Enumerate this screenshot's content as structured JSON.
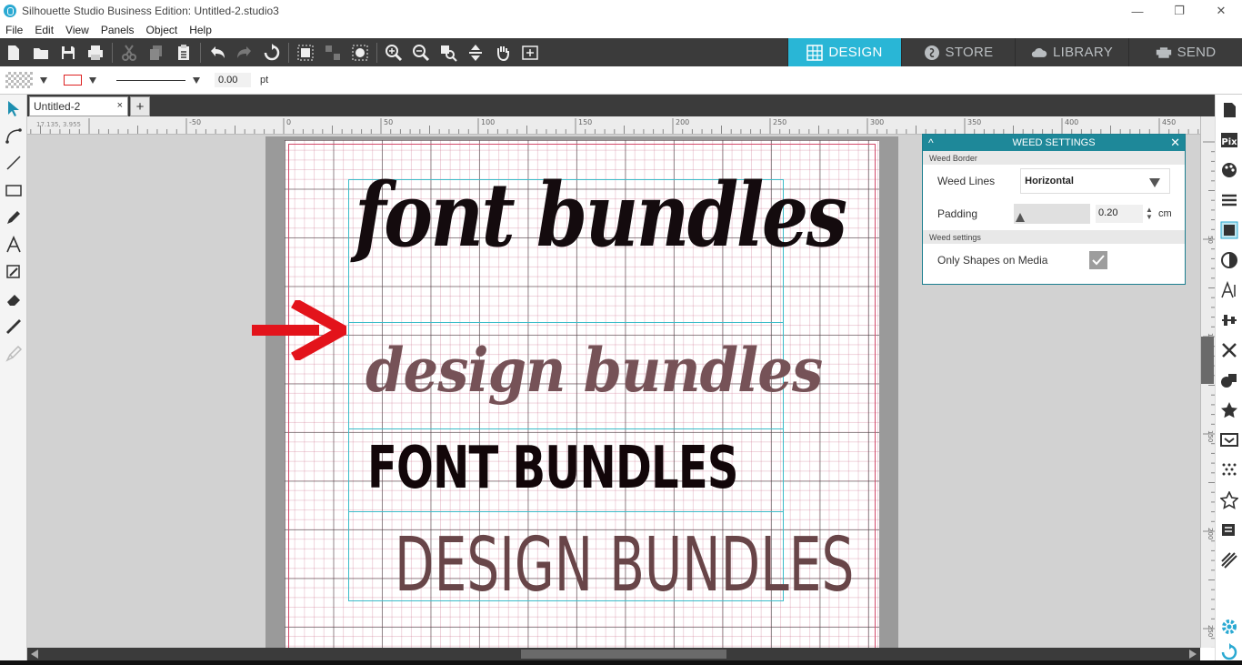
{
  "window": {
    "title": "Silhouette Studio Business Edition: Untitled-2.studio3",
    "controls": {
      "minimize": "—",
      "maximize": "❐",
      "close": "✕"
    }
  },
  "menu": [
    "File",
    "Edit",
    "View",
    "Panels",
    "Object",
    "Help"
  ],
  "toolbar": {
    "icons": [
      "new-icon",
      "open-icon",
      "save-icon",
      "print-icon",
      "cut-icon",
      "copy-icon",
      "paste-icon",
      "undo-icon",
      "redo-icon",
      "redraw-icon",
      "group-icon",
      "ungroup-icon",
      "compound-icon",
      "zoom-in-icon",
      "zoom-out-icon",
      "zoom-selection-icon",
      "fit-page-icon",
      "pan-icon",
      "fit-page-alt-icon"
    ]
  },
  "modes": [
    {
      "label": "DESIGN",
      "icon": "grid-icon",
      "active": true
    },
    {
      "label": "STORE",
      "icon": "store-icon",
      "active": false
    },
    {
      "label": "LIBRARY",
      "icon": "cloud-icon",
      "active": false
    },
    {
      "label": "SEND",
      "icon": "cutter-icon",
      "active": false
    }
  ],
  "linebar": {
    "line_width": "0.00",
    "unit": "pt"
  },
  "document": {
    "tab_label": "Untitled-2",
    "tab_close": "×",
    "add_tab": "+"
  },
  "ruler": {
    "coords": "17.135, 3.955",
    "top_labels": [
      "-50",
      "0",
      "50",
      "100",
      "150",
      "200",
      "250",
      "300",
      "350",
      "400",
      "450"
    ],
    "side_labels": [
      "50",
      "100",
      "150",
      "200",
      "250"
    ]
  },
  "canvas": {
    "texts": [
      "font bundles",
      "design bundles",
      "FONT BUNDLES",
      "DESIGN BUNDLES"
    ],
    "colors": {
      "text1": "#140b0e",
      "text2": "#765257",
      "text3": "#120609",
      "text4": "#684548",
      "selection": "#3cbcc9",
      "annotation_arrow": "#e3131b"
    }
  },
  "weed": {
    "title": "WEED SETTINGS",
    "collapse": "^",
    "close": "✕",
    "section_border": "Weed Border",
    "weed_lines_label": "Weed Lines",
    "weed_lines_value": "Horizontal",
    "padding_label": "Padding",
    "padding_value": "0.20",
    "padding_unit": "cm",
    "section_settings": "Weed settings",
    "only_shapes_label": "Only Shapes on Media",
    "only_shapes_checked": true
  },
  "right_panels": [
    "page-setup-icon",
    "pixscan-icon",
    "fill-icon",
    "line-style-icon",
    "trace-icon",
    "transparency-icon",
    "text-style-icon",
    "align-icon",
    "replicate-icon",
    "modify-icon",
    "offset-icon",
    "library-icon",
    "sketch-icon",
    "rhinestone-icon",
    "favorites-icon",
    "weed-icon",
    "settings-icon",
    "refresh-icon"
  ]
}
